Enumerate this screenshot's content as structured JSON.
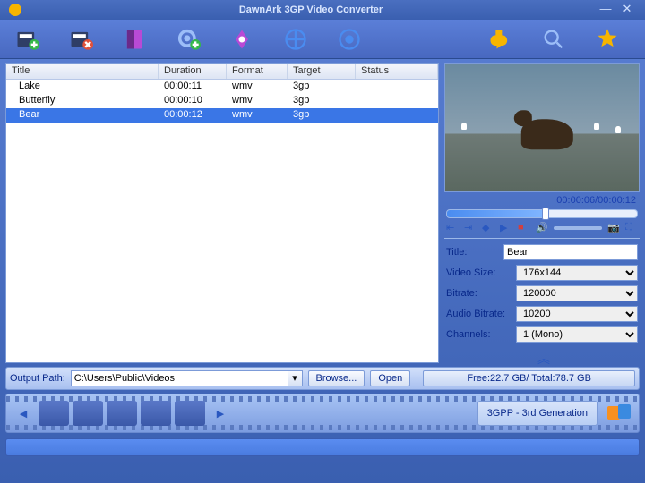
{
  "titlebar": {
    "title": "DawnArk 3GP Video Converter"
  },
  "columns": [
    "Title",
    "Duration",
    "Format",
    "Target",
    "Status"
  ],
  "rows": [
    {
      "title": "Lake",
      "duration": "00:00:11",
      "format": "wmv",
      "target": "3gp",
      "status": "",
      "selected": false
    },
    {
      "title": "Butterfly",
      "duration": "00:00:10",
      "format": "wmv",
      "target": "3gp",
      "status": "",
      "selected": false
    },
    {
      "title": "Bear",
      "duration": "00:00:12",
      "format": "wmv",
      "target": "3gp",
      "status": "",
      "selected": true
    }
  ],
  "preview": {
    "time": "00:00:06/00:00:12"
  },
  "form": {
    "title_label": "Title:",
    "title_value": "Bear",
    "videosize_label": "Video Size:",
    "videosize_value": "176x144",
    "bitrate_label": "Bitrate:",
    "bitrate_value": "120000",
    "audiobitrate_label": "Audio Bitrate:",
    "audiobitrate_value": "10200",
    "channels_label": "Channels:",
    "channels_value": "1 (Mono)"
  },
  "output": {
    "label": "Output Path:",
    "value": "C:\\Users\\Public\\Videos",
    "browse": "Browse...",
    "open": "Open",
    "disk": "Free:22.7 GB/ Total:78.7 GB"
  },
  "profile": {
    "label": "3GPP - 3rd Generation"
  }
}
